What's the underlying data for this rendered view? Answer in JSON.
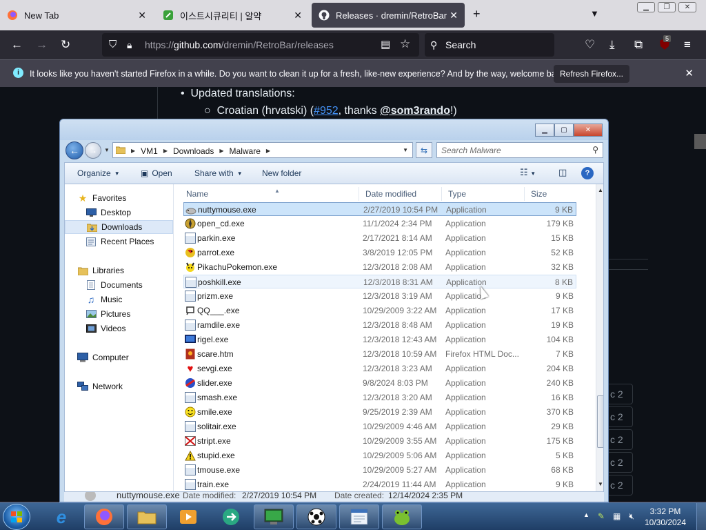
{
  "browser": {
    "tabs": [
      {
        "title": "New Tab",
        "icon": "firefox-icon"
      },
      {
        "title": "이스트시큐리티 | 알약",
        "icon": "alyac-icon"
      },
      {
        "title": "Releases · dremin/RetroBar",
        "icon": "github-icon"
      }
    ],
    "url_prefix": "https://",
    "url_host": "github.com",
    "url_path": "/dremin/RetroBar/releases",
    "search_placeholder": "Search",
    "extension_badge": "5",
    "notification": "It looks like you haven't started Firefox in a while. Do you want to clean it up for a fresh, like-new experience? And by the way, welcome back!",
    "refresh_button": "Refresh Firefox..."
  },
  "page": {
    "bullet_text": "Updated translations:",
    "sub_lang": "Croatian (hrvatski) (",
    "sub_link": "#952",
    "sub_mid": ", thanks ",
    "sub_user": "@som3rando",
    "sub_end": "!)",
    "side_labels": [
      "c 2",
      "c 2",
      "c 2",
      "c 2",
      "c 2"
    ]
  },
  "explorer": {
    "breadcrumbs": [
      "VM1",
      "Downloads",
      "Malware"
    ],
    "search_placeholder": "Search Malware",
    "commands": {
      "organize": "Organize",
      "open": "Open",
      "share_with": "Share with",
      "new_folder": "New folder"
    },
    "nav": {
      "favorites": "Favorites",
      "desktop": "Desktop",
      "downloads": "Downloads",
      "recent_places": "Recent Places",
      "libraries": "Libraries",
      "documents": "Documents",
      "music": "Music",
      "pictures": "Pictures",
      "videos": "Videos",
      "computer": "Computer",
      "network": "Network"
    },
    "columns": {
      "name": "Name",
      "date": "Date modified",
      "type": "Type",
      "size": "Size"
    },
    "files": [
      {
        "name": "nuttymouse.exe",
        "date": "2/27/2019 10:54 PM",
        "type": "Application",
        "size": "9 KB",
        "icon": "mouse-icon"
      },
      {
        "name": "open_cd.exe",
        "date": "11/1/2024 2:34 PM",
        "type": "Application",
        "size": "179 KB",
        "icon": "disc-icon"
      },
      {
        "name": "parkin.exe",
        "date": "2/17/2021 8:14 AM",
        "type": "Application",
        "size": "15 KB",
        "icon": "app-icon"
      },
      {
        "name": "parrot.exe",
        "date": "3/8/2019 12:05 PM",
        "type": "Application",
        "size": "52 KB",
        "icon": "parrot-icon"
      },
      {
        "name": "PikachuPokemon.exe",
        "date": "12/3/2018 2:08 AM",
        "type": "Application",
        "size": "32 KB",
        "icon": "pikachu-icon"
      },
      {
        "name": "poshkill.exe",
        "date": "12/3/2018 8:31 AM",
        "type": "Application",
        "size": "8 KB",
        "icon": "app-icon"
      },
      {
        "name": "prizm.exe",
        "date": "12/3/2018 3:19 AM",
        "type": "Application",
        "size": "9 KB",
        "icon": "app-icon"
      },
      {
        "name": "QQ___.exe",
        "date": "10/29/2009 3:22 AM",
        "type": "Application",
        "size": "17 KB",
        "icon": "qq-icon"
      },
      {
        "name": "ramdile.exe",
        "date": "12/3/2018 8:48 AM",
        "type": "Application",
        "size": "19 KB",
        "icon": "app-icon"
      },
      {
        "name": "rigel.exe",
        "date": "12/3/2018 12:43 AM",
        "type": "Application",
        "size": "104 KB",
        "icon": "monitor-icon"
      },
      {
        "name": "scare.htm",
        "date": "12/3/2018 10:59 AM",
        "type": "Firefox HTML Doc...",
        "size": "7 KB",
        "icon": "html-doc-icon"
      },
      {
        "name": "sevgi.exe",
        "date": "12/3/2018 3:23 AM",
        "type": "Application",
        "size": "204 KB",
        "icon": "heart-icon"
      },
      {
        "name": "slider.exe",
        "date": "9/8/2024 8:03 PM",
        "type": "Application",
        "size": "240 KB",
        "icon": "slider-icon"
      },
      {
        "name": "smash.exe",
        "date": "12/3/2018 3:20 AM",
        "type": "Application",
        "size": "16 KB",
        "icon": "app-icon"
      },
      {
        "name": "smile.exe",
        "date": "9/25/2019 2:39 AM",
        "type": "Application",
        "size": "370 KB",
        "icon": "smiley-icon"
      },
      {
        "name": "solitair.exe",
        "date": "10/29/2009 4:46 AM",
        "type": "Application",
        "size": "29 KB",
        "icon": "app-icon"
      },
      {
        "name": "stript.exe",
        "date": "10/29/2009 3:55 AM",
        "type": "Application",
        "size": "175 KB",
        "icon": "stripe-icon"
      },
      {
        "name": "stupid.exe",
        "date": "10/29/2009 5:06 AM",
        "type": "Application",
        "size": "5 KB",
        "icon": "warning-icon"
      },
      {
        "name": "tmouse.exe",
        "date": "10/29/2009 5:27 AM",
        "type": "Application",
        "size": "68 KB",
        "icon": "app-icon"
      },
      {
        "name": "train.exe",
        "date": "2/24/2019 11:44 AM",
        "type": "Application",
        "size": "9 KB",
        "icon": "app-icon"
      }
    ],
    "details": {
      "name": "nuttymouse.exe",
      "modified_label": "Date modified:",
      "modified": "2/27/2019 10:54 PM",
      "created_label": "Date created:",
      "created": "12/14/2024 2:35 PM"
    }
  },
  "taskbar": {
    "time": "3:32 PM",
    "date": "10/30/2024"
  }
}
